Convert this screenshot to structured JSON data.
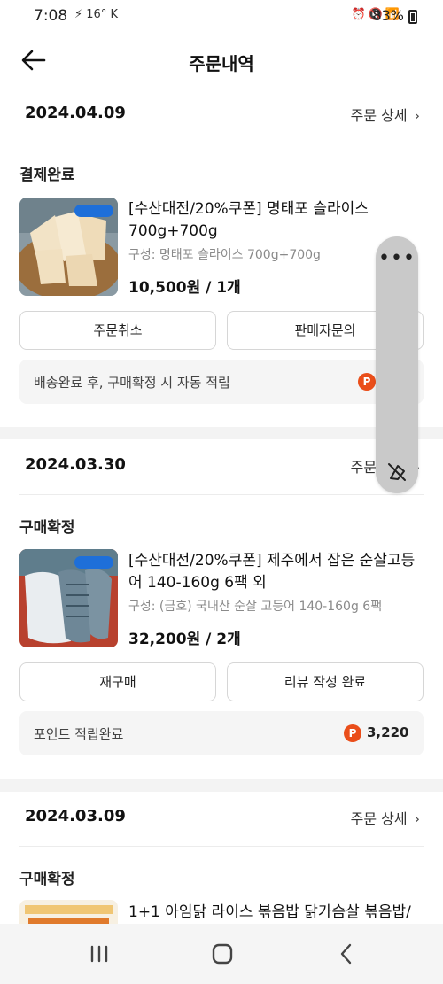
{
  "statusbar": {
    "time": "7:08",
    "left_extra": "16°",
    "battery": "83%"
  },
  "appbar": {
    "title": "주문내역",
    "back_icon": "arrow-left-icon"
  },
  "orders": [
    {
      "date": "2024.04.09",
      "detail_label": "주문 상세",
      "status": "결제완료",
      "product_name": "[수산대전/20%쿠폰] 명태포 슬라이스 700g+700g",
      "option": "구성: 명태포 슬라이스 700g+700g",
      "price": "10,500원 / 1개",
      "buttons": [
        "주문취소",
        "판매자문의"
      ],
      "info_text": "배송완료 후, 구매확정 시 자동 적립",
      "point_badge": "P"
    },
    {
      "date": "2024.03.30",
      "detail_label": "주문 상세",
      "status": "구매확정",
      "product_name": "[수산대전/20%쿠폰] 제주에서 잡은 순살고등어 140-160g 6팩 외",
      "option": "구성: (금호) 국내산 순살 고등어 140-160g 6팩",
      "price": "32,200원 / 2개",
      "buttons": [
        "재구매",
        "리뷰 작성 완료"
      ],
      "info_text": "포인트 적립완료",
      "point_badge": "P",
      "point_value": "3,220"
    },
    {
      "date": "2024.03.09",
      "detail_label": "주문 상세",
      "status": "구매확정",
      "product_name": "1+1 아임닭 라이스 볶음밥 닭가슴살 볶음밥/"
    }
  ],
  "floating_panel": {
    "menu_icon": "more-horizontal-icon",
    "dismiss_icon": "eraser-off-icon"
  },
  "navbar": {
    "recent_icon": "recent-apps-icon",
    "home_icon": "home-circle-icon",
    "back_icon": "nav-back-icon"
  },
  "colors": {
    "point_badge": "#ea4e1a",
    "divider": "#f3f3f3",
    "info_bg": "#f5f5f5"
  }
}
